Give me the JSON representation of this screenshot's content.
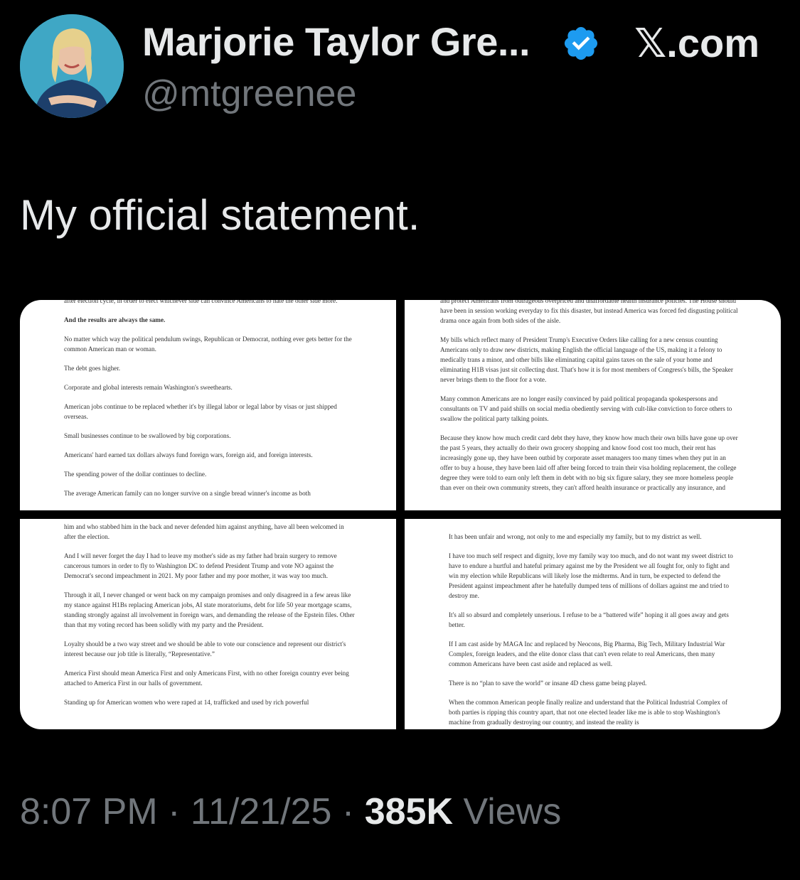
{
  "author": {
    "display_name": "Marjorie Taylor Gre...",
    "handle": "@mtgreenee",
    "verified_icon": "verified-badge-icon",
    "avatar": "profile-photo"
  },
  "brand": {
    "label": "𝕏.com"
  },
  "tweet": {
    "text": "My official statement."
  },
  "media": {
    "tile_1": {
      "paragraphs": [
        "after election cycle, in order to elect whichever side can convince Americans to hate the other side more.",
        "And the results are always the same.",
        "No matter which way the political pendulum swings, Republican or Democrat, nothing ever gets better for the common American man or woman.",
        "The debt goes higher.",
        "Corporate and global interests remain Washington's sweethearts.",
        "American jobs continue to be replaced whether it's by illegal labor or legal labor by visas or just shipped overseas.",
        "Small businesses continue to be swallowed by big corporations.",
        "Americans' hard earned tax dollars always fund foreign wars, foreign aid, and foreign interests.",
        "The spending power of the dollar continues to decline.",
        "The average American family can no longer survive on a single bread winner's income as both"
      ]
    },
    "tile_2": {
      "paragraphs": [
        "and protect Americans from outrageous overpriced and unaffordable health insurance policies. The House should have been in session working everyday to fix this disaster, but instead America was forced fed disgusting political drama once again from both sides of the aisle.",
        "My bills which reflect many of President Trump's Executive Orders like calling for a new census counting Americans only to draw new districts, making English the official language of the US, making it a felony to medically trans a minor, and other bills like eliminating capital gains taxes on the sale of your home and eliminating H1B visas just sit collecting dust. That's how it is for most members of Congress's bills, the Speaker never brings them to the floor for a vote.",
        "Many common Americans are no longer easily convinced by paid political propaganda spokespersons and consultants on TV and paid shills on social media obediently serving with cult-like conviction to force others to swallow the political party talking points.",
        "Because they know how much credit card debt they have, they know how much their own bills have gone up over the past 5 years, they actually do their own grocery shopping and know food cost too much, their rent has increasingly gone up, they have been outbid by corporate asset managers too many times when they put in an offer to buy a house, they have been laid off after being forced to train their visa holding replacement, the college degree they were told to earn only left them in debt with no big six figure salary, they see more homeless people than ever on their own community streets, they can't afford health insurance or practically any insurance, and"
      ]
    },
    "tile_3": {
      "paragraphs": [
        "him and who stabbed him in the back and never defended him against anything, have all been welcomed in after the election.",
        "And I will never forget the day I had to leave my mother's side as my father had brain surgery to remove cancerous tumors in order to fly to Washington DC to defend President Trump and vote NO against the Democrat's second impeachment in 2021. My poor father and my poor mother, it was way too much.",
        "Through it all, I never changed or went back on my campaign promises and only disagreed in a few areas like my stance against H1Bs replacing American jobs, AI state moratoriums, debt for life 50 year mortgage scams, standing strongly against all involvement in foreign wars, and demanding the release of the Epstein files. Other than that my voting record has been solidly with my party and the President.",
        "Loyalty should be a two way street and we should be able to vote our conscience and represent our district's interest because our job title is literally, “Representative.”",
        "America First should mean America First and only Americans First, with no other foreign country ever being attached to America First in our halls of government.",
        "Standing up for American women who were raped at 14, trafficked and used by rich powerful"
      ]
    },
    "tile_4": {
      "paragraphs": [
        "It has been unfair and wrong, not only to me and especially my family, but to my district as well.",
        "I have too much self respect and dignity, love my family way too much, and do not want my sweet district to have to endure a hurtful and hateful primary against me by the President we all fought for, only to fight and win my election while Republicans will likely lose the midterms. And in turn, be expected to defend the President against impeachment after he hatefully dumped tens of millions of dollars against me and tried to destroy me.",
        "It's all so absurd and completely unserious. I refuse to be a “battered wife” hoping it all goes away and gets better.",
        "If I am cast aside by MAGA Inc and replaced by Neocons, Big Pharma, Big Tech, Military Industrial War Complex, foreign leaders, and the elite donor class that can't even relate to real Americans, then many common Americans have been cast aside and replaced as well.",
        "There is no “plan to save the world” or insane 4D chess game being played.",
        "When the common American people finally realize and understand that the Political Industrial Complex of both parties is ripping this country apart, that not one elected leader like me is able to stop Washington's machine from gradually destroying our country, and instead the reality is"
      ]
    }
  },
  "meta": {
    "time": "8:07 PM",
    "separator": "·",
    "date": "11/21/25",
    "views_count": "385K",
    "views_label": "Views"
  },
  "colors": {
    "background": "#000000",
    "primary_text": "#e7e9ea",
    "secondary_text": "#71767b",
    "verified_blue": "#1d9bf0"
  }
}
